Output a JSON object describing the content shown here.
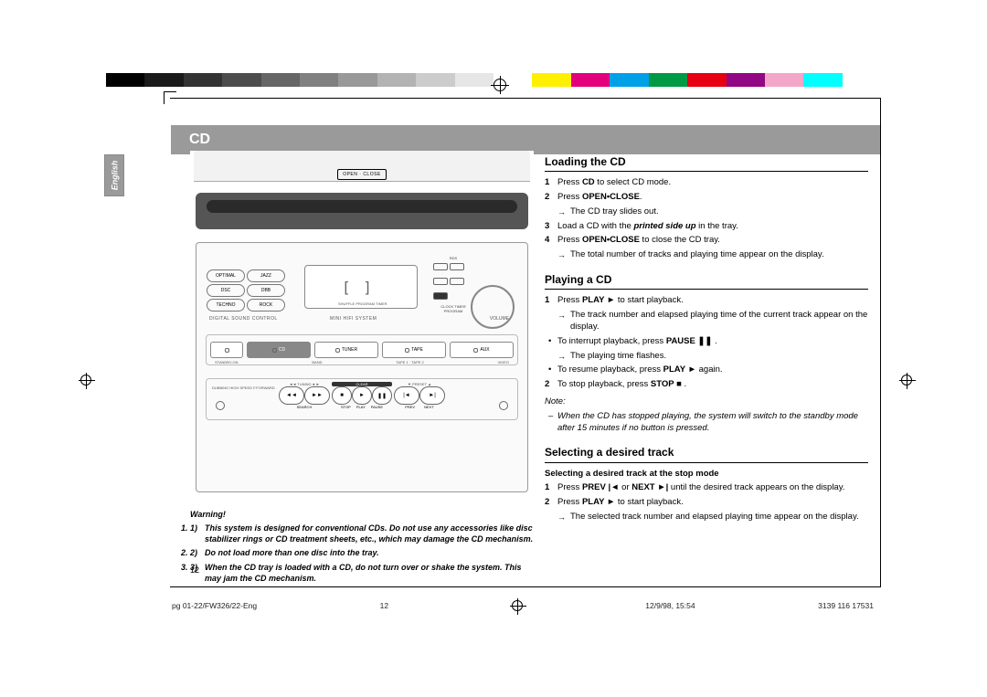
{
  "header": {
    "title": "CD",
    "lang_tab": "English"
  },
  "device": {
    "open_close": "OPEN · CLOSE",
    "dsc_buttons": [
      "OPTIMAL",
      "JAZZ",
      "DSC",
      "DBB",
      "TECHNO",
      "ROCK"
    ],
    "dsc_label": "DIGITAL SOUND CONTROL",
    "display_shuffle": "SHUFFLE  PROGRAM TIMER",
    "display_seg": "[ ]",
    "hifi_label": "MINI HIFI SYSTEM",
    "side_top": "RDS",
    "side_labels": "CLOCK  TIMER  PROGRAM",
    "volume_label": "VOLUME",
    "sources": {
      "power": "⏻",
      "cd": "CD",
      "tuner": "TUNER",
      "tape": "TAPE",
      "aux": "AUX"
    },
    "sub_labels": {
      "standby": "STANDBY-ON",
      "band": "BAND",
      "tape12": "TAPE 1 · TAPE 2",
      "video": "VIDEO"
    },
    "ctrl_left": "DUBBING\nHIGH SPEED\nF.FORWARD",
    "ctrl_tuning": "◄◄    TUNING    ►►",
    "ctrl_clear": "CLEAR",
    "ctrl_preset": "▼    PRESET    ▲",
    "transport": {
      "rev": "◄◄",
      "fwd": "►►",
      "stop": "■",
      "play": "►",
      "pause": "❚❚",
      "prev": "|◄",
      "next": "►|"
    },
    "bottom_labels": {
      "search": "SEARCH",
      "stop": "STOP",
      "play": "PLAY",
      "pause": "PAUSE",
      "prev": "PREV",
      "next": "NEXT"
    }
  },
  "warning": {
    "head": "Warning!",
    "items": [
      "This system is designed for conventional CDs. Do not use any accessories like disc stabilizer rings or CD treatment sheets, etc., which may damage the CD mechanism.",
      "Do not load more than one disc into the tray.",
      "When the CD tray is loaded with a CD, do not turn over or shake the system. This may jam the CD mechanism."
    ]
  },
  "loading": {
    "h": "Loading the CD",
    "s1a": "Press ",
    "s1b": "CD",
    "s1c": " to select CD mode.",
    "s2a": "Press ",
    "s2b": "OPEN•CLOSE",
    "s2c": ".",
    "s2arrow": "The CD tray slides out.",
    "s3a": "Load a CD with the ",
    "s3b": "printed side up",
    "s3c": " in the tray.",
    "s4a": "Press ",
    "s4b": "OPEN•CLOSE",
    "s4c": " to close the CD tray.",
    "s4arrow": "The total number of tracks and playing time appear on the display."
  },
  "playing": {
    "h": "Playing a CD",
    "s1a": "Press ",
    "s1b": "PLAY ►",
    "s1c": " to start playback.",
    "s1arrow": "The track number and elapsed playing time of the current track appear on the display.",
    "b1a": "To interrupt playback, press ",
    "b1b": "PAUSE ❚❚",
    "b1c": " .",
    "b1arrow": "The playing time flashes.",
    "b2a": "To resume playback, press ",
    "b2b": "PLAY ►",
    "b2c": " again.",
    "s2a": "To stop playback, press ",
    "s2b": "STOP ■",
    "s2c": " .",
    "note_h": "Note:",
    "note": "When the CD has stopped playing, the system will switch to the standby mode after 15 minutes if no button is pressed."
  },
  "selecting": {
    "h": "Selecting a desired track",
    "sub": "Selecting a desired track at the stop mode",
    "s1a": "Press ",
    "s1b": "PREV |◄",
    "s1c": " or ",
    "s1d": "NEXT ►|",
    "s1e": " until the desired track appears on the display.",
    "s2a": "Press ",
    "s2b": "PLAY ►",
    "s2c": " to start playback.",
    "s2arrow": "The selected track number and elapsed playing time appear on the display."
  },
  "page_num": "12",
  "footer": {
    "file": "pg 01-22/FW326/22-Eng",
    "page": "12",
    "date": "12/9/98, 15:54",
    "code": "3139 116 17531"
  },
  "colorbar": [
    "#000",
    "#1a1a1a",
    "#333",
    "#4d4d4d",
    "#666",
    "#808080",
    "#999",
    "#b3b3b3",
    "#ccc",
    "#e6e6e6",
    "#fff",
    "#fff000",
    "#e3007b",
    "#00a0e9",
    "#009944",
    "#e60012",
    "#920783",
    "#f4a6c9",
    "#00ffff",
    "#fff"
  ]
}
